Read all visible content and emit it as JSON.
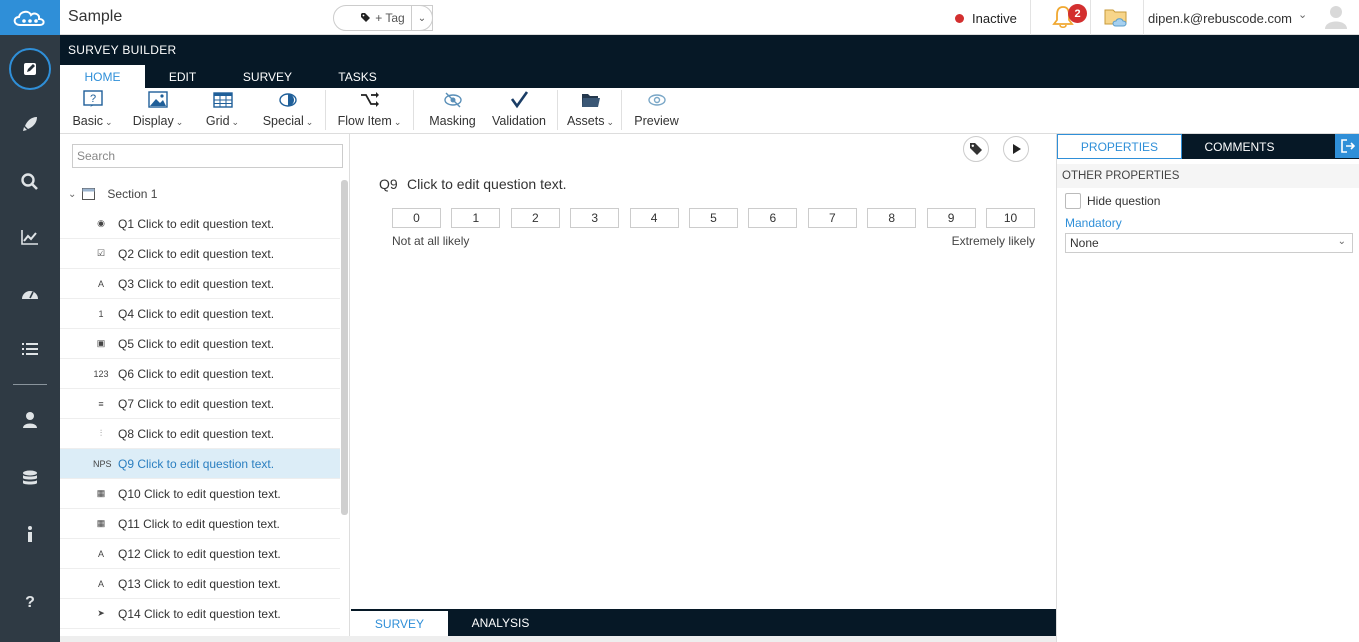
{
  "app": {
    "title": "Sample",
    "tag_button_label": "+ Tag",
    "status_text": "Inactive",
    "notification_count": "2",
    "user_email": "dipen.k@rebuscode.com"
  },
  "builder": {
    "title": "SURVEY BUILDER",
    "tabs": [
      {
        "label": "HOME"
      },
      {
        "label": "EDIT"
      },
      {
        "label": "SURVEY"
      },
      {
        "label": "TASKS"
      }
    ]
  },
  "ribbon": {
    "items": [
      {
        "label": "Basic",
        "icon": "question-box-icon"
      },
      {
        "label": "Display",
        "icon": "image-icon"
      },
      {
        "label": "Grid",
        "icon": "grid-icon"
      },
      {
        "label": "Special",
        "icon": "special-eye-icon"
      },
      {
        "label": "Flow Item",
        "icon": "flow-icon"
      },
      {
        "label": "Masking",
        "icon": "masking-eye-icon"
      },
      {
        "label": "Validation",
        "icon": "checkmark-icon"
      },
      {
        "label": "Assets",
        "icon": "folder-icon"
      },
      {
        "label": "Preview",
        "icon": "preview-eye-icon"
      }
    ]
  },
  "question_panel": {
    "search_placeholder": "Search",
    "section_label": "Section 1",
    "questions": [
      {
        "label": "Q1 Click to edit question text.",
        "icon_text": "◉"
      },
      {
        "label": "Q2 Click to edit question text.",
        "icon_text": "☑"
      },
      {
        "label": "Q3 Click to edit question text.",
        "icon_text": "A"
      },
      {
        "label": "Q4 Click to edit question text.",
        "icon_text": "1"
      },
      {
        "label": "Q5 Click to edit question text.",
        "icon_text": "▣"
      },
      {
        "label": "Q6 Click to edit question text.",
        "icon_text": "123"
      },
      {
        "label": "Q7 Click to edit question text.",
        "icon_text": "≡"
      },
      {
        "label": "Q8 Click to edit question text.",
        "icon_text": "⫶"
      },
      {
        "label": "Q9 Click to edit question text.",
        "icon_text": "NPS"
      },
      {
        "label": "Q10 Click to edit question text.",
        "icon_text": "▦"
      },
      {
        "label": "Q11 Click to edit question text.",
        "icon_text": "▦"
      },
      {
        "label": "Q12 Click to edit question text.",
        "icon_text": "A"
      },
      {
        "label": "Q13 Click to edit question text.",
        "icon_text": "A"
      },
      {
        "label": "Q14 Click to edit question text.",
        "icon_text": "➤"
      }
    ],
    "selected_index": 8
  },
  "canvas": {
    "question_number": "Q9",
    "question_text": "Click to edit question text.",
    "scale": [
      "0",
      "1",
      "2",
      "3",
      "4",
      "5",
      "6",
      "7",
      "8",
      "9",
      "10"
    ],
    "low_label": "Not at all likely",
    "high_label": "Extremely likely"
  },
  "bottom_tabs": [
    {
      "label": "SURVEY"
    },
    {
      "label": "ANALYSIS"
    }
  ],
  "properties": {
    "tabs": [
      {
        "label": "PROPERTIES"
      },
      {
        "label": "COMMENTS"
      }
    ],
    "section_title": "OTHER PROPERTIES",
    "hide_question_label": "Hide question",
    "mandatory_label": "Mandatory",
    "mandatory_value": "None"
  },
  "colors": {
    "accent": "#2f8fd8",
    "rail": "#2f3a44",
    "header": "#061826",
    "status_inactive": "#d32f2f",
    "selected_row": "#dcedf7"
  }
}
